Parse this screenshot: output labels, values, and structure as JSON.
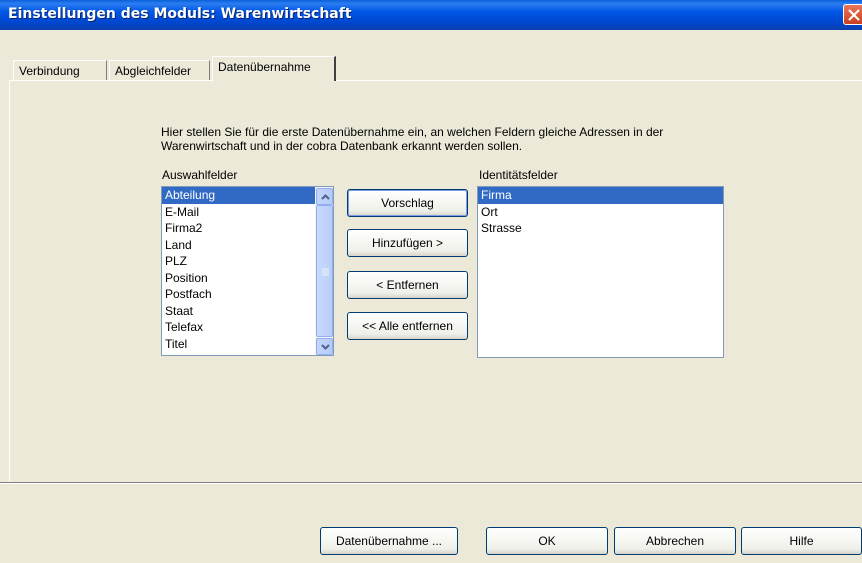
{
  "window": {
    "title": "Einstellungen des Moduls: Warenwirtschaft"
  },
  "tabs": [
    {
      "label": "Verbindung"
    },
    {
      "label": "Abgleichfelder"
    },
    {
      "label": "Datenübernahme",
      "active": true
    }
  ],
  "description": "Hier stellen Sie für die erste Datenübernahme ein, an welchen Feldern gleiche Adressen in der Warenwirtschaft und in der cobra Datenbank erkannt werden sollen.",
  "auswahl": {
    "label": "Auswahlfelder",
    "items": [
      "Abteilung",
      "E-Mail",
      "Firma2",
      "Land",
      "PLZ",
      "Position",
      "Postfach",
      "Staat",
      "Telefax",
      "Titel"
    ],
    "selected": "Abteilung"
  },
  "identitaet": {
    "label": "Identitätsfelder",
    "items": [
      "Firma",
      "Ort",
      "Strasse"
    ],
    "selected": "Firma"
  },
  "actions": {
    "vorschlag": "Vorschlag",
    "hinzufuegen": "Hinzufügen >",
    "entfernen": "< Entfernen",
    "alle_entfernen": "<< Alle entfernen"
  },
  "footer": {
    "datenuebernahme": "Datenübernahme ...",
    "ok": "OK",
    "abbrechen": "Abbrechen",
    "hilfe": "Hilfe"
  }
}
